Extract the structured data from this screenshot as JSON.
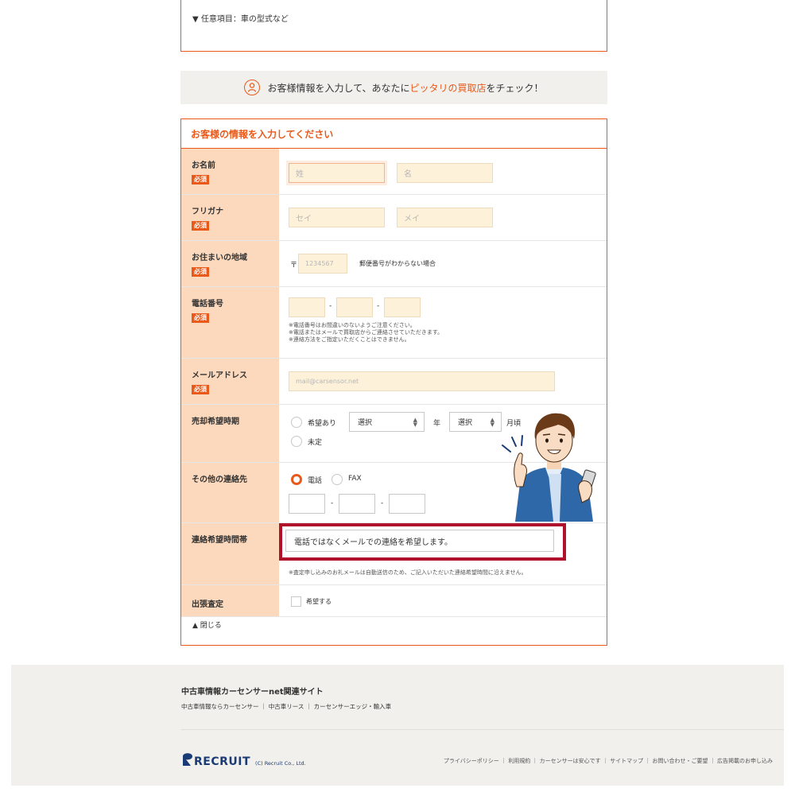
{
  "top": {
    "optional_link": "▼ 任意項目：車の型式など"
  },
  "banner": {
    "prefix": "お客様情報を入力して、あなたに",
    "highlight": "ピッタリの買取店",
    "suffix": "をチェック！"
  },
  "form": {
    "title": "お客様の情報を入力してください",
    "required_badge": "必須",
    "name": {
      "label": "お名前",
      "last_placeholder": "姓",
      "first_placeholder": "名"
    },
    "kana": {
      "label": "フリガナ",
      "last_placeholder": "セイ",
      "first_placeholder": "メイ"
    },
    "address": {
      "label": "お住まいの地域",
      "postal_mark": "〒",
      "postal_placeholder": "1234567",
      "unknown_link": "郵便番号がわからない場合"
    },
    "phone": {
      "label": "電話番号",
      "dash": "-",
      "notes": [
        "※電話番号はお間違いのないようご注意ください。",
        "※電話またはメールで買取店からご連絡させていただきます。",
        "※連絡方法をご指定いただくことはできません。"
      ]
    },
    "email": {
      "label": "メールアドレス",
      "placeholder": "mail@carsensor.net"
    },
    "sale_timing": {
      "label": "売却希望時期",
      "option_yes": "希望あり",
      "year_select": "選択",
      "year_unit": "年",
      "month_select": "選択",
      "month_unit": "月頃",
      "option_undecided": "未定"
    },
    "other_contact": {
      "label": "その他の連絡先",
      "option_tel": "電話",
      "option_fax": "FAX",
      "dash": "-"
    },
    "contact_time": {
      "label": "連絡希望時間帯",
      "value": "電話ではなくメールでの連絡を希望します。",
      "notes": [
        "※査定申し込みのお礼メールは自動送信のため、ご記入いただいた連絡希望時間に沿えません。"
      ]
    },
    "visit": {
      "label": "出張査定",
      "checkbox_label": "希望する"
    },
    "close_link": "▲ 閉じる"
  },
  "footer": {
    "title": "中古車情報カーセンサーnet関連サイト",
    "links": "中古車情報ならカーセンサー ｜ 中古車リース ｜ カーセンサーエッジ・輸入車",
    "logo_text": "RECRUIT",
    "copyright": "(C) Recruit Co., Ltd.",
    "right_links": "プライバシーポリシー ｜ 利用規約 ｜ カーセンサーは安心です ｜ サイトマップ ｜ お問い合わせ・ご要望 ｜ 広告掲載のお申し込み"
  },
  "colors": {
    "accent": "#e95a1a",
    "label_bg": "#fcd9bd",
    "highlight_border": "#b0122b",
    "footer_bg": "#f1f0ec"
  }
}
